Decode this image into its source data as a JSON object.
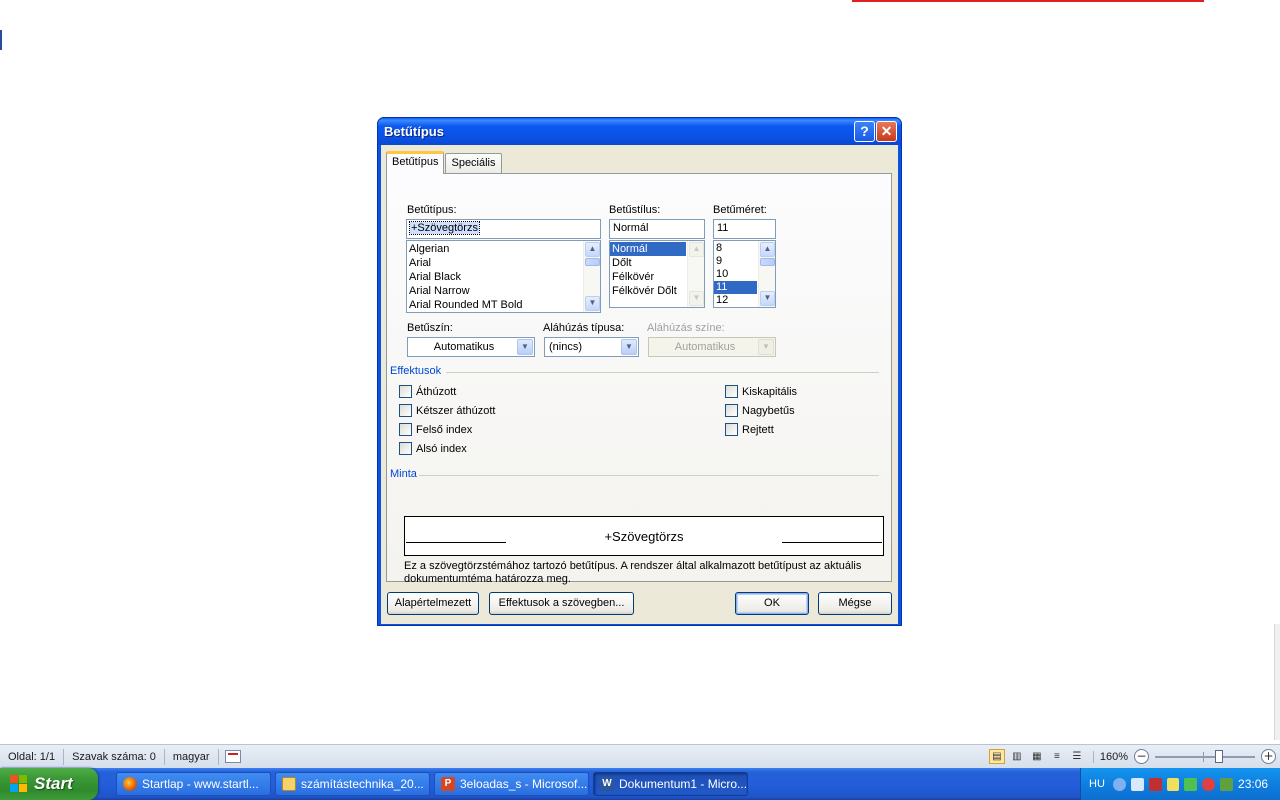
{
  "dialog": {
    "title": "Betűtípus",
    "help_label": "?",
    "close_label": "✕",
    "tabs": [
      {
        "label": "Betűtípus"
      },
      {
        "label": "Speciális"
      }
    ],
    "font": {
      "label": "Betűtípus:",
      "value": "+Szövegtörzs",
      "items": [
        "Algerian",
        "Arial",
        "Arial Black",
        "Arial Narrow",
        "Arial Rounded MT Bold"
      ]
    },
    "style": {
      "label": "Betűstílus:",
      "value": "Normál",
      "items": [
        "Normál",
        "Dőlt",
        "Félkövér",
        "Félkövér Dőlt"
      ],
      "selected": "Normál"
    },
    "size": {
      "label": "Betűméret:",
      "value": "11",
      "items": [
        "8",
        "9",
        "10",
        "11",
        "12"
      ],
      "selected": "11"
    },
    "color": {
      "label": "Betűszín:",
      "value": "Automatikus"
    },
    "underline_type": {
      "label": "Aláhúzás típusa:",
      "value": "(nincs)"
    },
    "underline_color": {
      "label": "Aláhúzás színe:",
      "value": "Automatikus"
    },
    "effects": {
      "title": "Effektusok",
      "left": [
        {
          "label": "Áthúzott",
          "checked": false
        },
        {
          "label": "Kétszer áthúzott",
          "checked": false
        },
        {
          "label": "Felső index",
          "checked": false
        },
        {
          "label": "Alsó index",
          "checked": false
        }
      ],
      "right": [
        {
          "label": "Kiskapitális",
          "checked": false
        },
        {
          "label": "Nagybetűs",
          "checked": false
        },
        {
          "label": "Rejtett",
          "checked": false
        }
      ]
    },
    "preview": {
      "title": "Minta",
      "sample": "+Szövegtörzs",
      "description": "Ez a szövegtörzstémához tartozó betűtípus. A rendszer által alkalmazott betűtípust az aktuális dokumentumtéma határozza meg."
    },
    "buttons": {
      "default": "Alapértelmezett",
      "text_effects": "Effektusok a szövegben...",
      "ok": "OK",
      "cancel": "Mégse"
    }
  },
  "statusbar": {
    "page": "Oldal: 1/1",
    "words": "Szavak száma: 0",
    "language": "magyar",
    "zoom": "160%",
    "zoom_level_percent": 160
  },
  "taskbar": {
    "start_label": "Start",
    "windows": [
      {
        "label": "Startlap - www.startl...",
        "icon": "firefox-icon",
        "active": false
      },
      {
        "label": "számítástechnika_20...",
        "icon": "folder-icon",
        "active": false
      },
      {
        "label": "3eloadas_s - Microsof...",
        "icon": "powerpoint-icon",
        "active": false
      },
      {
        "label": "Dokumentum1 - Micro...",
        "icon": "word-icon",
        "active": true
      }
    ],
    "tray": {
      "lang": "HU",
      "time": "23:06"
    }
  }
}
